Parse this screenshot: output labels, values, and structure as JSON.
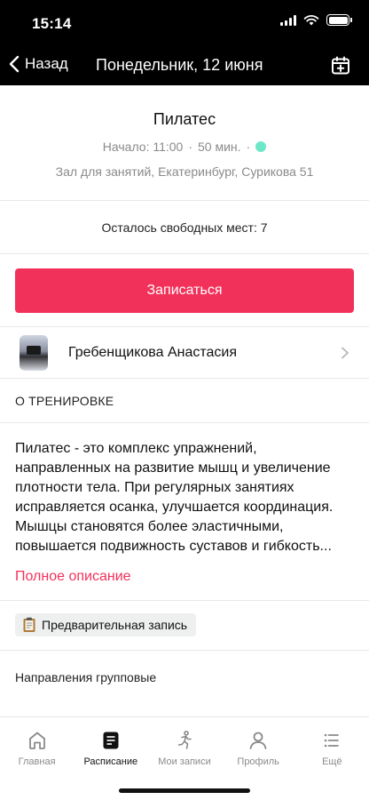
{
  "status": {
    "time": "15:14"
  },
  "nav": {
    "back_label": "Назад",
    "title": "Понедельник, 12 июня"
  },
  "workout": {
    "title": "Пилатес",
    "start": "Начало: 11:00",
    "separator": "·",
    "duration": "50 мин.",
    "location": "Зал для занятий, Екатеринбург, Сурикова 51",
    "seats_text": "Осталось свободных мест: 7"
  },
  "actions": {
    "signup_label": "Записаться"
  },
  "trainer": {
    "name": "Гребенщикова Анастасия"
  },
  "about": {
    "header": "О ТРЕНИРОВКЕ",
    "lines": [
      "Пилатес - это комплекс упражнений,",
      "направленных на развитие мышц и увеличение",
      "плотности тела. При регулярных занятиях",
      "исправляется осанка, улучшается координация.",
      "Мышцы становятся более эластичными,",
      "повышается подвижность суставов и гибкость..."
    ],
    "more_link": "Полное описание"
  },
  "tag": {
    "label": "Предварительная запись"
  },
  "directions": {
    "label": "Направления групповые"
  },
  "tabs": [
    {
      "label": "Главная",
      "icon": "home-icon"
    },
    {
      "label": "Расписание",
      "icon": "schedule-icon"
    },
    {
      "label": "Мои записи",
      "icon": "person-run-icon"
    },
    {
      "label": "Профиль",
      "icon": "profile-icon"
    },
    {
      "label": "Ещё",
      "icon": "more-icon"
    }
  ],
  "colors": {
    "accent": "#f2315a",
    "status_dot": "#6ee7c8",
    "bar": "#000000"
  }
}
